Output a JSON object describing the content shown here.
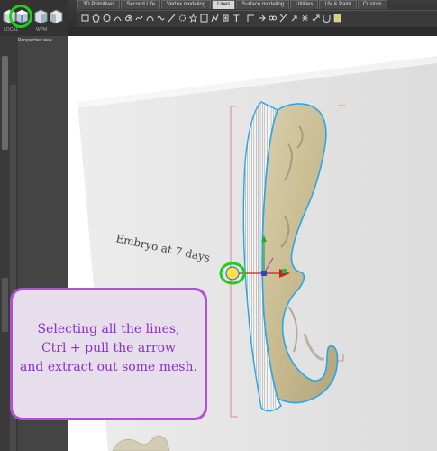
{
  "toolbar": {
    "tabs": [
      "3D Primitives",
      "Second Life",
      "Vertex modeling",
      "Lines",
      "Surface modeling",
      "Utilities",
      "UV & Paint",
      "Custom"
    ],
    "active_tab": "Lines",
    "tool_text": "T",
    "lower_labels": [
      "LOCAL",
      "WPM"
    ]
  },
  "viewport": {
    "title": "Perspective view"
  },
  "canvas_text": "Embryo at 7 days",
  "callout": {
    "line1": "Selecting all the lines,",
    "line2": "Ctrl + pull the arrow",
    "line3": "and extract out some mesh."
  },
  "colors": {
    "highlight": "#22cc22",
    "callout_border": "#b14fd8",
    "callout_text": "#8a2fc8",
    "line_blue": "#29a6e6"
  }
}
